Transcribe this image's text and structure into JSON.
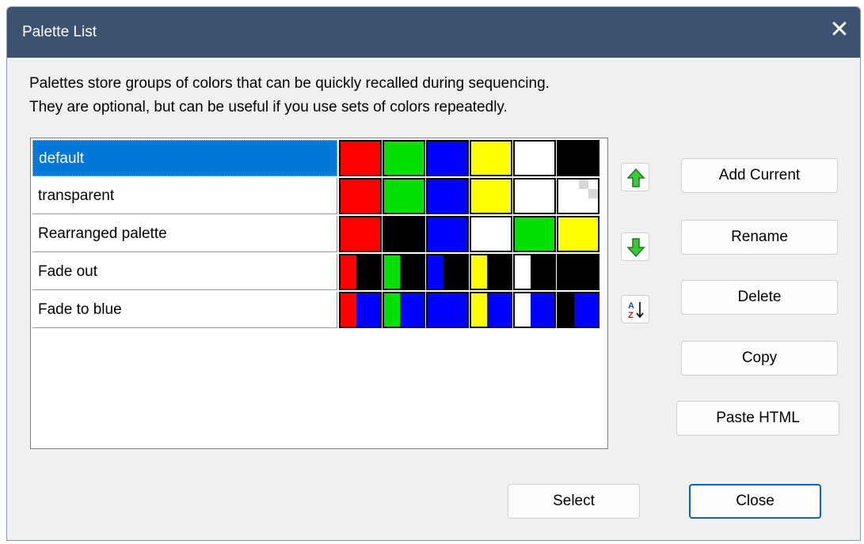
{
  "window": {
    "title": "Palette List",
    "close_glyph": "✕"
  },
  "description": {
    "line1": "Palettes store groups of colors that can be quickly recalled during sequencing.",
    "line2": "They are optional, but can be useful if you use sets of colors repeatedly."
  },
  "palettes": [
    {
      "name": "default",
      "selected": true,
      "swatches": [
        [
          "#ff0000"
        ],
        [
          "#00e000"
        ],
        [
          "#0000ff"
        ],
        [
          "#ffff00"
        ],
        [
          "#ffffff"
        ],
        [
          "#000000"
        ]
      ]
    },
    {
      "name": "transparent",
      "selected": false,
      "swatches": [
        [
          "#ff0000"
        ],
        [
          "#00e000"
        ],
        [
          "#0000ff"
        ],
        [
          "#ffff00"
        ],
        [
          "#ffffff"
        ],
        [
          "transparent"
        ]
      ]
    },
    {
      "name": "Rearranged palette",
      "selected": false,
      "swatches": [
        [
          "#ff0000"
        ],
        [
          "#000000"
        ],
        [
          "#0000ff"
        ],
        [
          "#ffffff"
        ],
        [
          "#00e000"
        ],
        [
          "#ffff00"
        ]
      ]
    },
    {
      "name": "Fade out",
      "selected": false,
      "swatches": [
        [
          "#ff0000",
          "#000000"
        ],
        [
          "#00e000",
          "#000000"
        ],
        [
          "#0000ff",
          "#000000"
        ],
        [
          "#ffff00",
          "#000000"
        ],
        [
          "#ffffff",
          "#000000"
        ],
        [
          "#000000",
          "#000000"
        ]
      ]
    },
    {
      "name": "Fade to blue",
      "selected": false,
      "swatches": [
        [
          "#ff0000",
          "#0000ff"
        ],
        [
          "#00e000",
          "#0000ff"
        ],
        [
          "#0000ff",
          "#0000ff"
        ],
        [
          "#ffff00",
          "#0000ff"
        ],
        [
          "#ffffff",
          "#0000ff"
        ],
        [
          "#000000",
          "#0000ff"
        ]
      ]
    }
  ],
  "side_icons": {
    "move_up": "arrow-up-icon",
    "move_down": "arrow-down-icon",
    "sort": "sort-az-icon"
  },
  "buttons": {
    "add_current": "Add Current",
    "rename": "Rename",
    "delete": "Delete",
    "copy": "Copy",
    "paste_html": "Paste HTML",
    "select": "Select",
    "close": "Close"
  },
  "colors": {
    "titlebar": "#3b5271",
    "selection": "#0078d7",
    "default_button_border": "#0067c0"
  }
}
